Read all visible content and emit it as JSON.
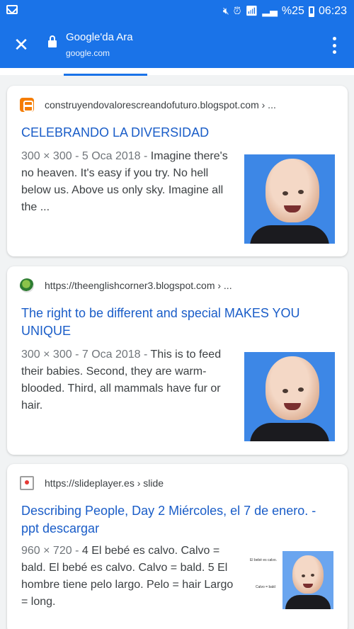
{
  "status_bar": {
    "battery_percent": "%25",
    "time": "06:23",
    "icons": [
      "mute-icon",
      "alarm-icon",
      "wifi-icon",
      "signal-icon",
      "battery-icon"
    ]
  },
  "app_bar": {
    "title": "Google'da Ara",
    "url": "google.com"
  },
  "results": [
    {
      "site": "construyendovalorescreandofuturo.blogspot.com › ...",
      "favicon": "blogger-icon",
      "title": "CELEBRANDO LA DIVERSIDAD",
      "meta": "300 × 300 - 5 Oca 2018 - ",
      "snippet": "Imagine there's no heaven. It's easy if you try. No hell below us. Above us only sky. Imagine all the ..."
    },
    {
      "site": "https://theenglishcorner3.blogspot.com › ...",
      "favicon": "englishcorner-icon",
      "title": "The right to be different and special MAKES YOU UNIQUE",
      "meta": "300 × 300 - 7 Oca 2018 - ",
      "snippet": "This is to feed their babies. Second, they are warm-blooded. Third, all mammals have fur or hair."
    },
    {
      "site": "https://slideplayer.es › slide",
      "favicon": "slideplayer-icon",
      "title": "Describing People, Day 2 Miércoles, el 7 de enero. - ppt descargar",
      "meta": "960 × 720 - ",
      "snippet": "4 El bebé es calvo. Calvo = bald. El bebé es calvo. Calvo = bald. 5 El hombre tiene pelo largo. Pelo = hair Largo = long.",
      "thumb_caption": "El bebé es calvo.",
      "thumb_sub": "Calvo = bald"
    }
  ],
  "colors": {
    "accent": "#1a73e8",
    "link": "#1a5dc8"
  }
}
